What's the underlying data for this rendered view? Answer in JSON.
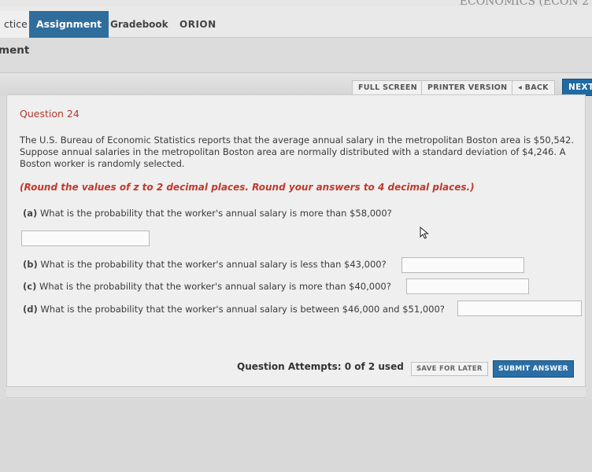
{
  "header": {
    "course_title": "ECONOMICS (ECON 2"
  },
  "tabs": [
    {
      "label": "ctice"
    },
    {
      "label": "Assignment"
    },
    {
      "label": "Gradebook"
    },
    {
      "label": "ORION"
    }
  ],
  "section_label": "ment",
  "toolbar": {
    "full_screen": "FULL SCREEN",
    "printer_version": "PRINTER VERSION",
    "back": "◂ BACK",
    "next": "NEXT"
  },
  "question": {
    "title": "Question 24",
    "text": "The U.S. Bureau of Economic Statistics reports that the average annual salary in the metropolitan Boston area is $50,542. Suppose annual salaries in the metropolitan Boston area are normally distributed with a standard deviation of $4,246. A Boston worker is randomly selected.",
    "instructions": "(Round the values of z to 2 decimal places. Round your answers to 4 decimal places.)",
    "parts": [
      {
        "label": "(a)",
        "text": "What is the probability that the worker's annual salary is more than $58,000?",
        "value": ""
      },
      {
        "label": "(b)",
        "text": "What is the probability that the worker's annual salary is less than $43,000?",
        "value": ""
      },
      {
        "label": "(c)",
        "text": "What is the probability that the worker's annual salary is more than $40,000?",
        "value": ""
      },
      {
        "label": "(d)",
        "text": "What is the probability that the worker's annual salary is between $46,000 and $51,000?",
        "value": ""
      }
    ]
  },
  "footer": {
    "attempts": "Question Attempts: 0 of 2 used",
    "save_label": "SAVE FOR LATER",
    "submit_label": "SUBMIT ANSWER"
  },
  "colors": {
    "accent": "#2f6d9c",
    "question_title": "#b03a2e",
    "instruction": "#c0392b"
  },
  "icons": {
    "pointer": "mouse-pointer-icon"
  }
}
